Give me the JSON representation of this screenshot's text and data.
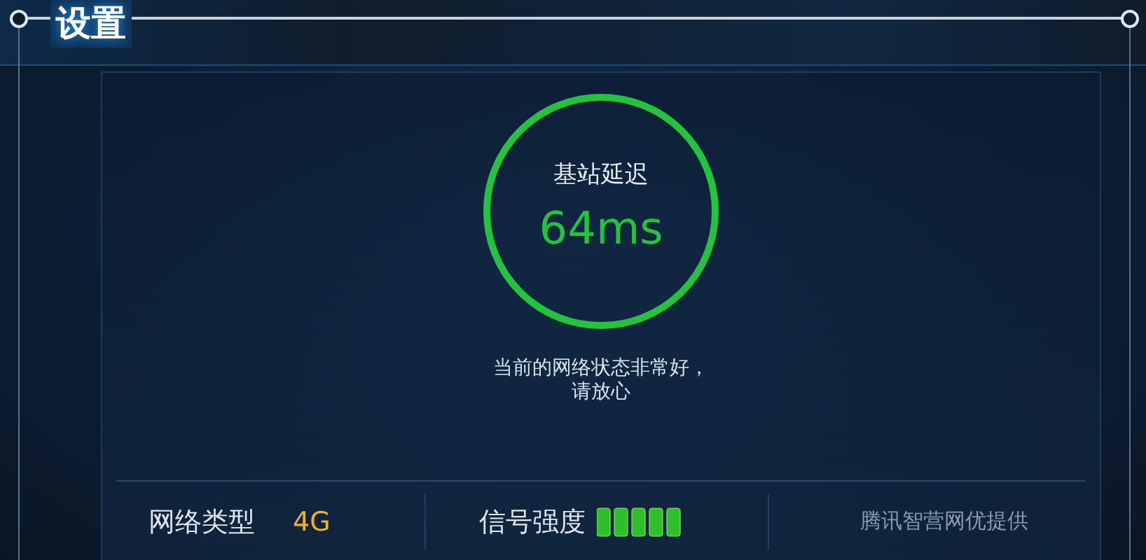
{
  "window": {
    "title": "设置"
  },
  "latency": {
    "label": "基站延迟",
    "value": "64ms",
    "message": "当前的网络状态非常好，",
    "message_line2": "请放心"
  },
  "status": {
    "network_label": "网络类型",
    "network_value": "4G",
    "signal_label": "信号强度",
    "provider": "腾讯智营网优提供"
  }
}
